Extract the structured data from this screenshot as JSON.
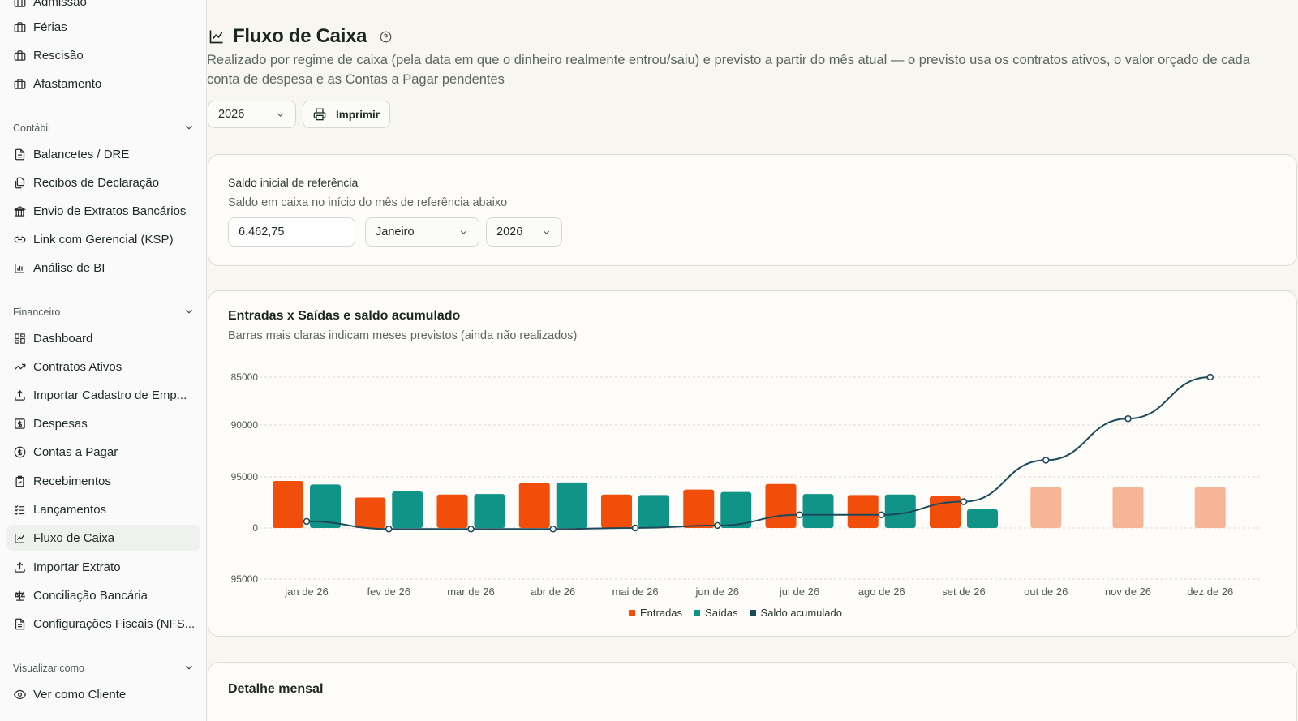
{
  "sidebar": {
    "items_top": [
      {
        "label": "Admissão",
        "icon": "briefcase-icon"
      },
      {
        "label": "Férias",
        "icon": "briefcase-icon"
      },
      {
        "label": "Rescisão",
        "icon": "briefcase-icon"
      },
      {
        "label": "Afastamento",
        "icon": "briefcase-icon"
      }
    ],
    "contabil": {
      "title": "Contábil",
      "items": [
        {
          "label": "Balancetes / DRE",
          "icon": "file-text-icon"
        },
        {
          "label": "Recibos de Declaração",
          "icon": "files-icon"
        },
        {
          "label": "Envio de Extratos Bancários",
          "icon": "bank-icon"
        },
        {
          "label": "Link com Gerencial (KSP)",
          "icon": "link-icon"
        },
        {
          "label": "Análise de BI",
          "icon": "bar-chart-icon"
        }
      ]
    },
    "financeiro": {
      "title": "Financeiro",
      "items": [
        {
          "label": "Dashboard",
          "icon": "dashboard-icon"
        },
        {
          "label": "Contratos Ativos",
          "icon": "trending-up-icon"
        },
        {
          "label": "Importar Cadastro de Emp...",
          "icon": "upload-icon"
        },
        {
          "label": "Despesas",
          "icon": "dollar-square-icon"
        },
        {
          "label": "Contas a Pagar",
          "icon": "dollar-circle-icon"
        },
        {
          "label": "Recebimentos",
          "icon": "clipboard-check-icon"
        },
        {
          "label": "Lançamentos",
          "icon": "list-check-icon"
        },
        {
          "label": "Fluxo de Caixa",
          "icon": "line-chart-icon",
          "active": true
        },
        {
          "label": "Importar Extrato",
          "icon": "upload-icon"
        },
        {
          "label": "Conciliação Bancária",
          "icon": "scale-icon"
        },
        {
          "label": "Configurações Fiscais (NFS...",
          "icon": "file-text-icon"
        }
      ]
    },
    "visualizar": {
      "title": "Visualizar como",
      "items": [
        {
          "label": "Ver como Cliente",
          "icon": "eye-icon"
        }
      ]
    }
  },
  "header": {
    "title": "Fluxo de Caixa",
    "description": "Realizado por regime de caixa (pela data em que o dinheiro realmente entrou/saiu) e previsto a partir do mês atual — o previsto usa os contratos ativos, o valor orçado de cada conta de despesa e as Contas a Pagar pendentes",
    "year_select": "2026",
    "print_label": "Imprimir"
  },
  "saldo_card": {
    "title": "Saldo inicial de referência",
    "subtitle": "Saldo em caixa no início do mês de referência abaixo",
    "value": "6.462,75",
    "month": "Janeiro",
    "year": "2026"
  },
  "chart_card": {
    "title": "Entradas x Saídas e saldo acumulado",
    "subtitle": "Barras mais claras indicam meses previstos (ainda não realizados)"
  },
  "detail_card": {
    "title": "Detalhe mensal"
  },
  "colors": {
    "entradas": "#f04e0a",
    "saidas": "#119488",
    "saldo": "#1b4a5c",
    "previsto": "#f7b597"
  },
  "chart_data": {
    "type": "bar",
    "categories": [
      "jan de 26",
      "fev de 26",
      "mar de 26",
      "abr de 26",
      "mai de 26",
      "jun de 26",
      "jul de 26",
      "ago de 26",
      "set de 26",
      "out de 26",
      "nov de 26",
      "dez de 26"
    ],
    "y_tick_labels": [
      "85000",
      "90000",
      "95000",
      "0",
      "95000"
    ],
    "series": [
      {
        "name": "Entradas",
        "values": [
          46500,
          30000,
          33000,
          44500,
          33000,
          38000,
          43500,
          32500,
          31500,
          40500,
          40500,
          40500
        ]
      },
      {
        "name": "Saídas",
        "values": [
          43000,
          36000,
          33500,
          45000,
          32500,
          35500,
          33500,
          33000,
          18500,
          0,
          0,
          0
        ]
      },
      {
        "name": "Saldo acumulado",
        "values": [
          6500,
          -1000,
          -1000,
          -1000,
          0,
          2500,
          13000,
          13000,
          26000,
          67000,
          108000,
          149000
        ]
      }
    ],
    "forecast_from_index": 9,
    "ylim": [
      -50000,
      155000
    ],
    "grid": true,
    "legend_position": "bottom"
  }
}
